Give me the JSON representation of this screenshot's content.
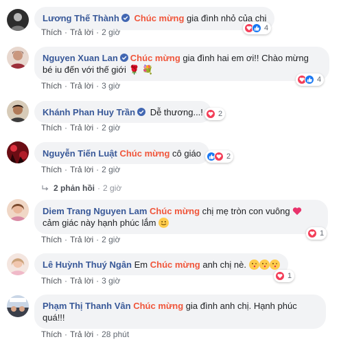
{
  "comments": [
    {
      "name": "Lương Thế Thành",
      "tag": "Chúc mừng",
      "text": "gia đình nhỏ của chị",
      "reaction_count": "4",
      "actions": {
        "like": "Thích",
        "reply": "Trả lời",
        "time": "2 giờ"
      }
    },
    {
      "name": "Nguyen Xuan Lan",
      "tag": "Chúc mừng",
      "text_line1": "gia đình hai em ơi!! Chào mừng",
      "text_line2": "bé iu đến với thế giới 🌹 💐",
      "reaction_count": "4",
      "actions": {
        "like": "Thích",
        "reply": "Trả lời",
        "time": "3 giờ"
      }
    },
    {
      "name": "Khánh Phan Huy Trần",
      "text": "Dễ thương...!",
      "reaction_count": "2",
      "actions": {
        "like": "Thích",
        "reply": "Trả lời",
        "time": "2 giờ"
      }
    },
    {
      "name": "Nguyễn Tiến Luật",
      "tag": "Chúc mừng",
      "text": "cô giáo",
      "reaction_count": "2",
      "actions": {
        "like": "Thích",
        "reply": "Trả lời",
        "time": "2 giờ"
      },
      "replies": {
        "label": "2 phản hồi",
        "time": "2 giờ"
      }
    },
    {
      "name": "Diem Trang Nguyen Lam",
      "tag": "Chúc mừng",
      "text_line1": "chị mẹ tròn con vuông",
      "text_line2": "cảm giác này hạnh phúc lắm",
      "reaction_count": "1",
      "actions": {
        "like": "Thích",
        "reply": "Trả lời",
        "time": "2 giờ"
      }
    },
    {
      "name": "Lê Huỳnh Thuý Ngân",
      "prefix": "Em",
      "tag": "Chúc mừng",
      "text": "anh chị nè.",
      "reaction_count": "1",
      "actions": {
        "like": "Thích",
        "reply": "Trả lời",
        "time": "3 giờ"
      }
    },
    {
      "name": "Phạm Thị Thanh Vân",
      "tag": "Chúc mừng",
      "text_line1": "gia đình anh chị. Hạnh phúc",
      "text_line2": "quá!!!",
      "actions": {
        "like": "Thích",
        "reply": "Trả lời",
        "time": "28 phút"
      }
    }
  ],
  "separator": "·",
  "colors": {
    "name": "#385898",
    "tag": "#f0553a",
    "bubble": "#f2f3f5",
    "love": "#f33e58",
    "like": "#1877f2",
    "verified": "#4267b2"
  }
}
